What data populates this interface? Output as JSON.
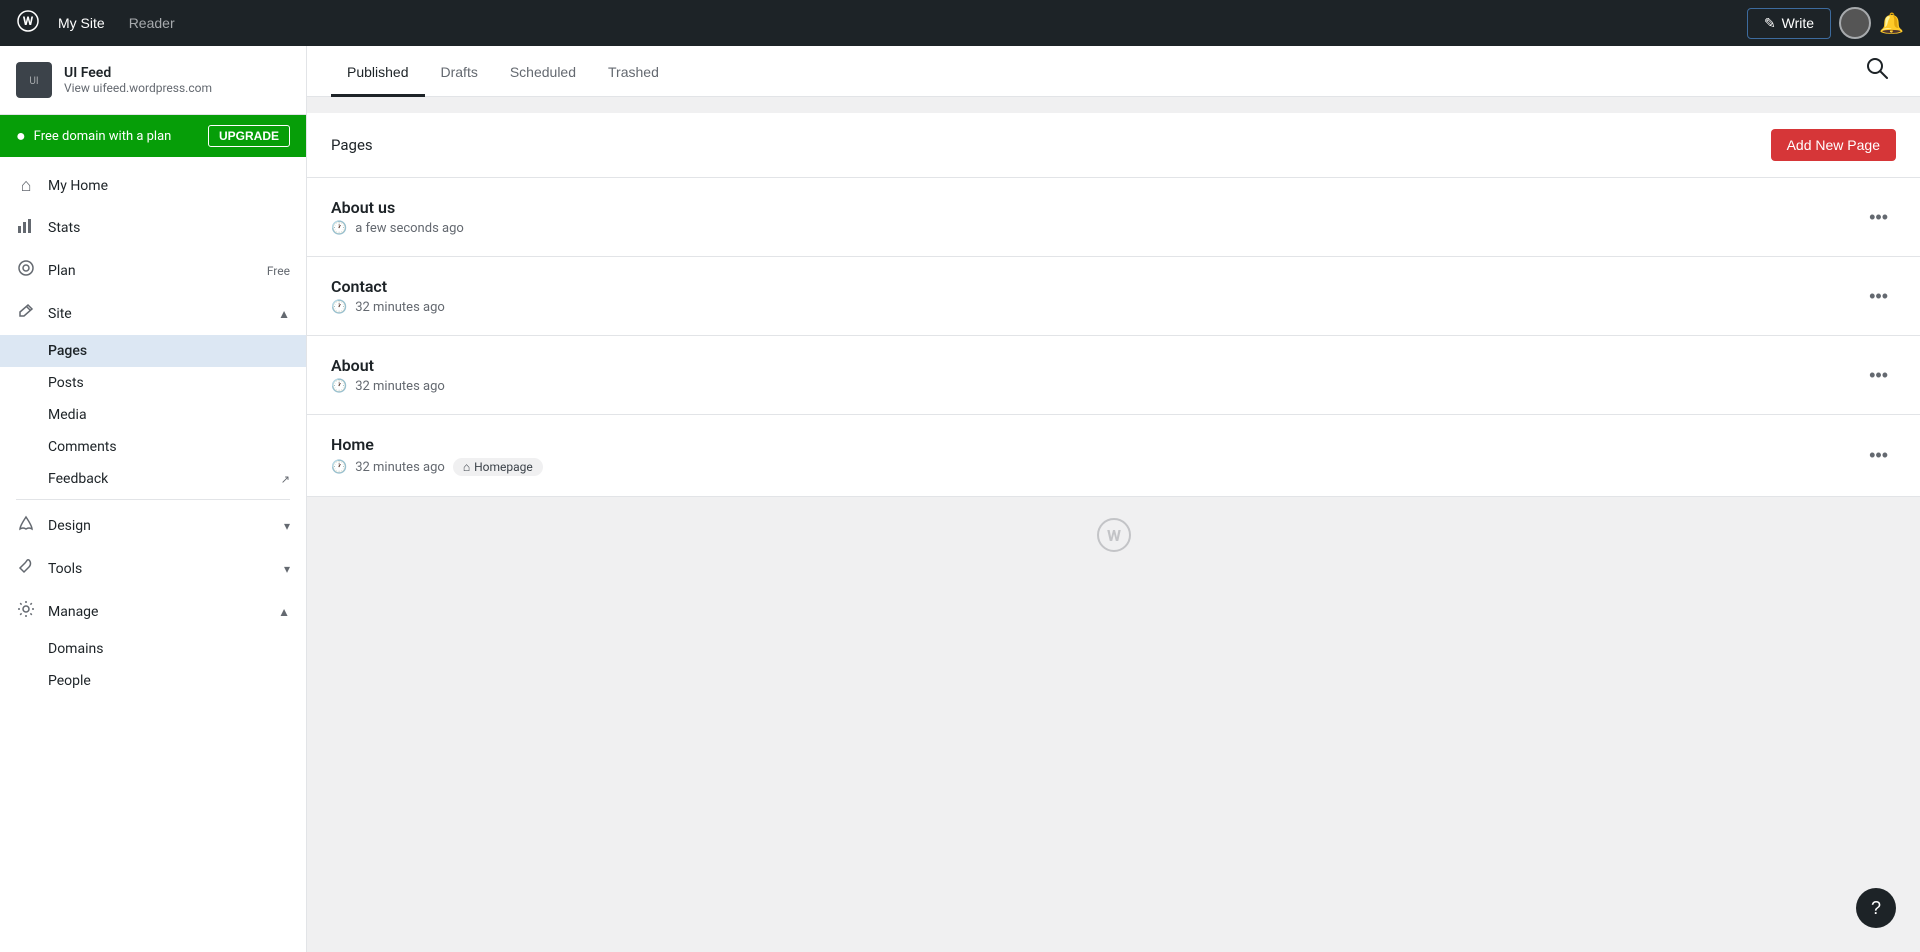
{
  "topNav": {
    "logoLabel": "W",
    "mySiteLabel": "My Site",
    "readerLabel": "Reader",
    "writeLabel": "Write",
    "writeIcon": "✎"
  },
  "sidebar": {
    "siteName": "UI Feed",
    "siteUrl": "View uifeed.wordpress.com",
    "siteIconLabel": "UI",
    "upgradeBanner": {
      "text": "Free domain with a plan",
      "buttonLabel": "UPGRADE"
    },
    "navItems": [
      {
        "id": "my-home",
        "label": "My Home",
        "icon": "⌂"
      },
      {
        "id": "stats",
        "label": "Stats",
        "icon": "📊"
      },
      {
        "id": "plan",
        "label": "Plan",
        "icon": "◎",
        "badge": "Free"
      },
      {
        "id": "site",
        "label": "Site",
        "icon": "✏",
        "chevron": "▲"
      }
    ],
    "subNavItems": [
      {
        "id": "pages",
        "label": "Pages",
        "active": true
      },
      {
        "id": "posts",
        "label": "Posts"
      },
      {
        "id": "media",
        "label": "Media"
      },
      {
        "id": "comments",
        "label": "Comments"
      },
      {
        "id": "feedback",
        "label": "Feedback",
        "external": true
      }
    ],
    "lowerNavItems": [
      {
        "id": "design",
        "label": "Design",
        "icon": "✦",
        "chevron": "▾"
      },
      {
        "id": "tools",
        "label": "Tools",
        "icon": "🔧",
        "chevron": "▾"
      },
      {
        "id": "manage",
        "label": "Manage",
        "icon": "⚙",
        "chevron": "▲"
      }
    ],
    "manageSubItems": [
      {
        "id": "domains",
        "label": "Domains"
      },
      {
        "id": "people",
        "label": "People"
      }
    ]
  },
  "tabs": [
    {
      "id": "published",
      "label": "Published",
      "active": true
    },
    {
      "id": "drafts",
      "label": "Drafts"
    },
    {
      "id": "scheduled",
      "label": "Scheduled"
    },
    {
      "id": "trashed",
      "label": "Trashed"
    }
  ],
  "pagesSection": {
    "title": "Pages",
    "addNewLabel": "Add New Page"
  },
  "pages": [
    {
      "id": "about-us",
      "name": "About us",
      "time": "a few seconds ago"
    },
    {
      "id": "contact",
      "name": "Contact",
      "time": "32 minutes ago"
    },
    {
      "id": "about",
      "name": "About",
      "time": "32 minutes ago"
    },
    {
      "id": "home",
      "name": "Home",
      "time": "32 minutes ago",
      "badge": "Homepage",
      "badgeIcon": "⌂"
    }
  ],
  "helpButtonLabel": "?"
}
